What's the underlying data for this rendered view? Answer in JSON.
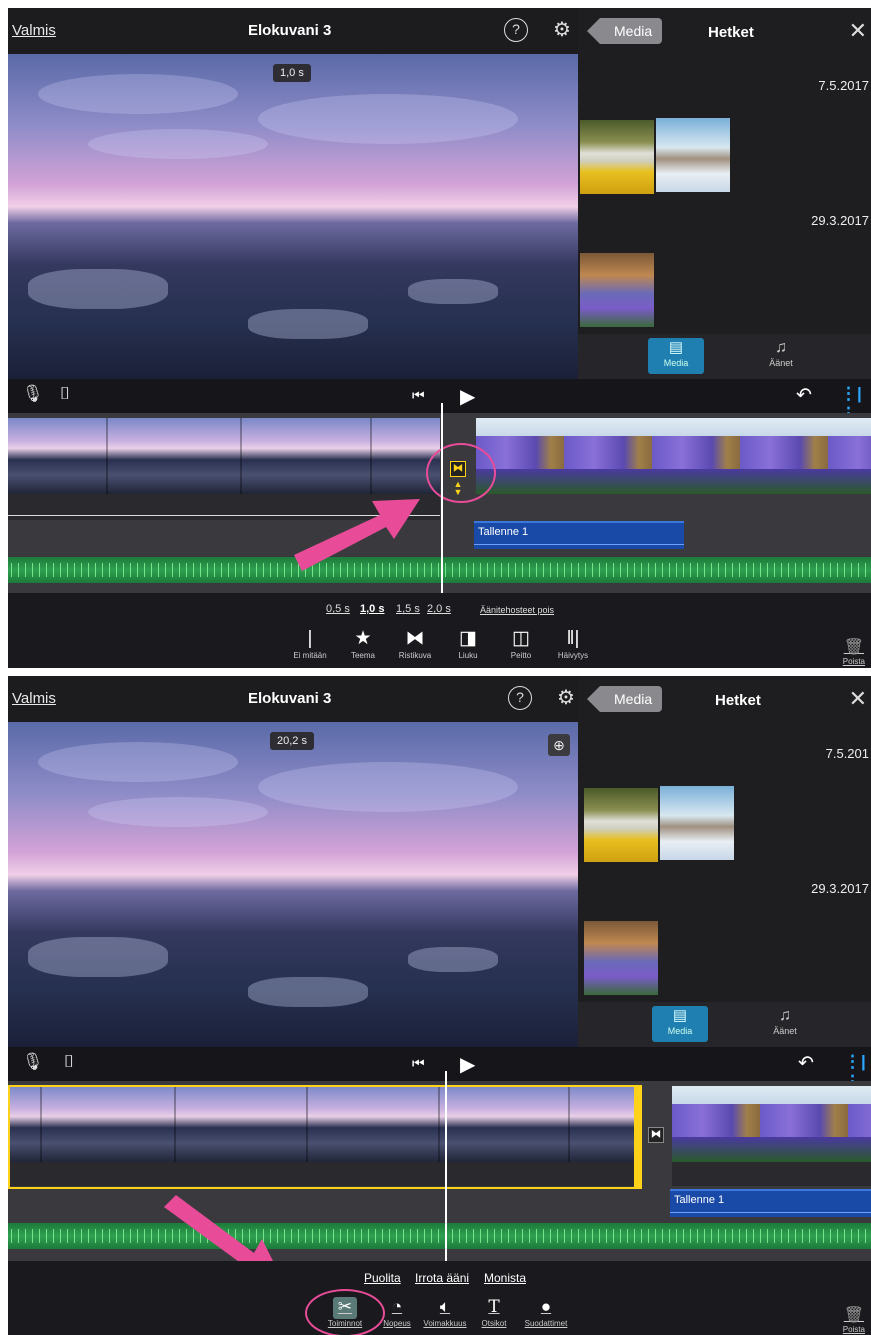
{
  "screens": [
    {
      "topbar": {
        "done": "Valmis",
        "title": "Elokuvani 3",
        "help": "?",
        "settings": "⚙"
      },
      "preview": {
        "duration": "1,0 s"
      },
      "browser": {
        "back": "Media",
        "title": "Hetket",
        "close": "✕",
        "date1": "7.5.2017",
        "date2": "29.3.2017",
        "tabs": [
          {
            "label": "Media",
            "icon": "film-icon"
          },
          {
            "label": "Äänet",
            "icon": "music-note-icon"
          }
        ]
      },
      "timeline": {
        "recording_label": "Tallenne 1"
      },
      "transition_options": {
        "durations": [
          "0,5 s",
          "1,0 s",
          "1,5 s",
          "2,0 s"
        ],
        "selected_duration": "1,0 s",
        "sound_toggle": "Äänitehosteet pois"
      },
      "transition_types": [
        "Ei mitään",
        "Teema",
        "Ristikuva",
        "Liuku",
        "Peitto",
        "Häivytys"
      ],
      "delete": "Poista"
    },
    {
      "topbar": {
        "done": "Valmis",
        "title": "Elokuvani 3",
        "help": "?",
        "settings": "⚙"
      },
      "preview": {
        "duration": "20,2 s"
      },
      "browser": {
        "back": "Media",
        "title": "Hetket",
        "close": "✕",
        "date1": "7.5.201",
        "date2": "29.3.2017",
        "tabs": [
          {
            "label": "Media",
            "icon": "film-icon"
          },
          {
            "label": "Äänet",
            "icon": "music-note-icon"
          }
        ]
      },
      "timeline": {
        "recording_label": "Tallenne 1"
      },
      "clip_actions": [
        "Puolita",
        "Irrota ääni",
        "Monista"
      ],
      "inspector_tools": [
        "Toiminnot",
        "Nopeus",
        "Voimakkuus",
        "Otsikot",
        "Suodattimet"
      ],
      "delete": "Poista"
    }
  ],
  "colors": {
    "accent_yellow": "#ffd21a",
    "annotation_pink": "#e84c98",
    "media_tab_blue": "#1f7fb0",
    "audio_green": "#2fa050",
    "recording_blue": "#1a4aa8"
  }
}
